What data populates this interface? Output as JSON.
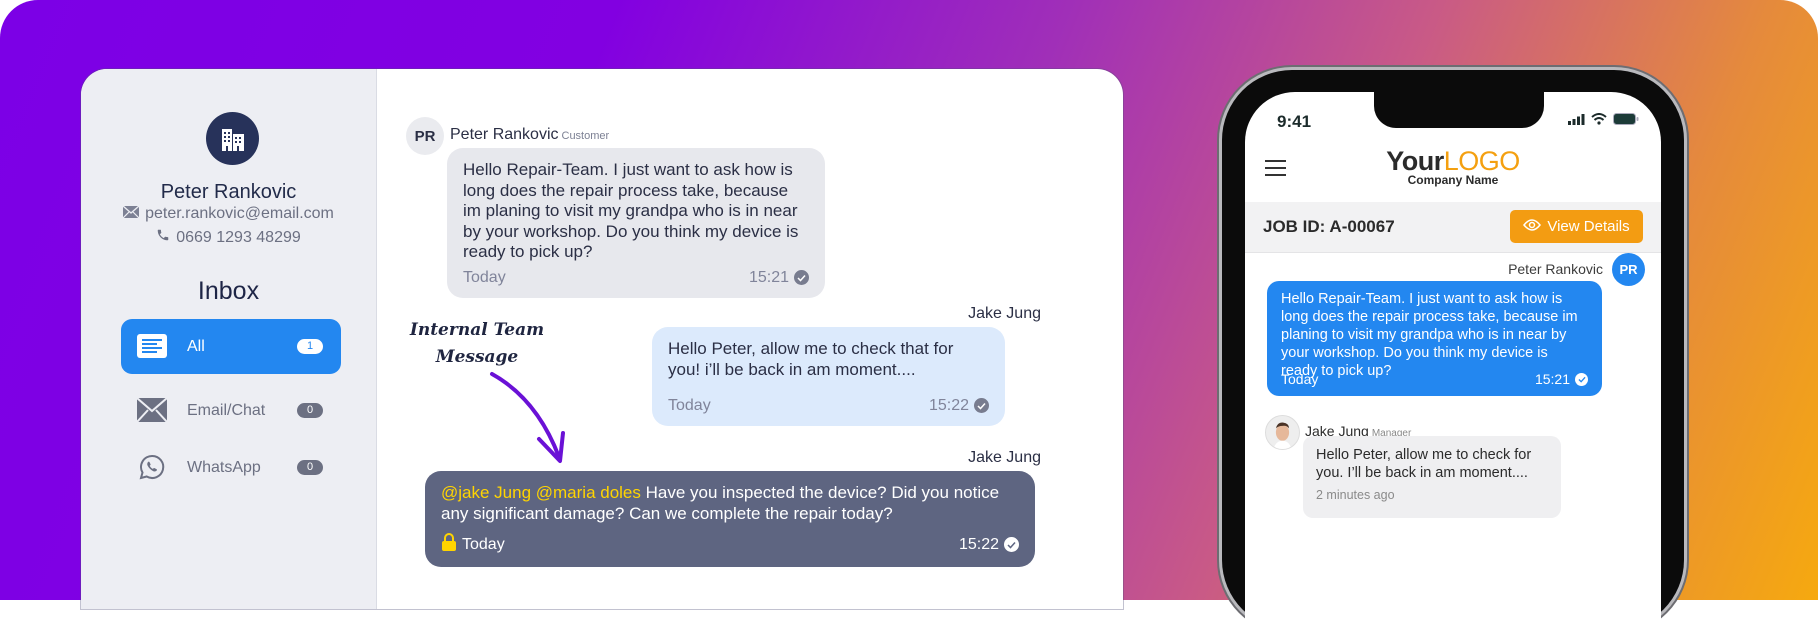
{
  "colors": {
    "gradient_start": "#7c00e6",
    "gradient_end": "#f6a90f",
    "primary_blue": "#2387f0",
    "dark_navy": "#27325a",
    "internal_bubble": "#5e6581",
    "mention_yellow": "#ffd400",
    "logo_orange": "#f4a010",
    "view_details_orange": "#f39c12"
  },
  "sidebar": {
    "org_icon": "buildings-icon",
    "profile_name": "Peter Rankovic",
    "email": "peter.rankovic@email.com",
    "phone": "0669 1293 48299",
    "inbox_title": "Inbox",
    "items": [
      {
        "label": "All",
        "count": "1",
        "icon": "document-list-icon",
        "active": true
      },
      {
        "label": "Email/Chat",
        "count": "0",
        "icon": "envelope-icon",
        "active": false
      },
      {
        "label": "WhatsApp",
        "count": "0",
        "icon": "whatsapp-icon",
        "active": false
      }
    ]
  },
  "chat": {
    "messages": [
      {
        "avatar_initials": "PR",
        "sender": "Peter Rankovic",
        "role": "Customer",
        "text": "Hello Repair-Team. I just want to ask how is long does the repair process take, because im planing to visit my grandpa who is in near by your workshop. Do you think my device is ready to pick up?",
        "day": "Today",
        "time": "15:21"
      },
      {
        "sender": "Jake Jung",
        "text": "Hello Peter, allow me to check that for you!  i’ll be back in am moment....",
        "day": "Today",
        "time": "15:22"
      },
      {
        "sender": "Jake Jung",
        "mentions": "@jake Jung @maria doles",
        "text": " Have you inspected the device? Did you notice any significant damage? Can we complete the repair today?",
        "day": "Today",
        "time": "15:22",
        "internal": true
      }
    ],
    "annotation_line1": "Internal Team",
    "annotation_line2": "Message"
  },
  "phone": {
    "status_time": "9:41",
    "logo_main": "Your",
    "logo_accent": "LOGO",
    "company_name": "Company Name",
    "job_id": "JOB ID: A-00067",
    "view_details_label": "View Details",
    "messages": [
      {
        "sender": "Peter Rankovic",
        "avatar_initials": "PR",
        "text": "Hello Repair-Team. I just want to ask how is long does the repair process take, because im planing to visit my grandpa who is in near by your workshop. Do you think my device is ready to pick up?",
        "day": "Today",
        "time": "15:21"
      },
      {
        "sender": "Jake Jung",
        "role": "Manager",
        "text": "Hello Peter, allow me to check for you. I’ll be back in am moment....",
        "ago": "2 minutes ago"
      }
    ]
  }
}
